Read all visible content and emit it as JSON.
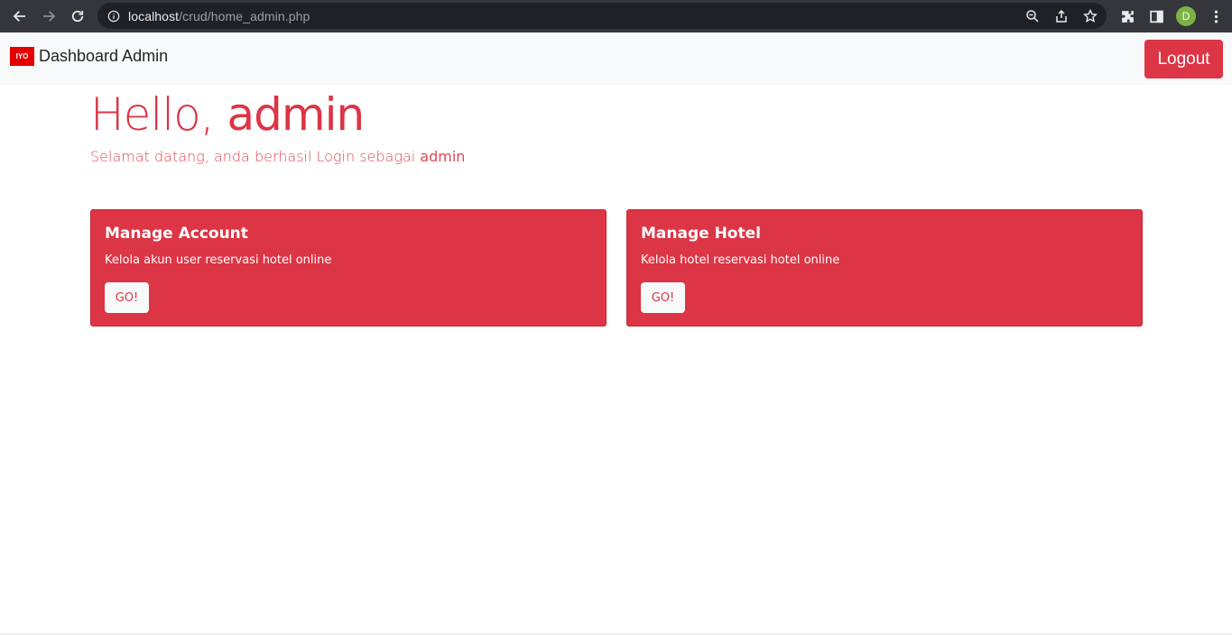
{
  "browser": {
    "url_host": "localhost",
    "url_path": "/crud/home_admin.php",
    "profile_initial": "D",
    "icons": [
      "back-icon",
      "forward-icon",
      "reload-icon",
      "info-icon",
      "zoom-icon",
      "share-icon",
      "star-icon",
      "extensions-icon",
      "side-panel-icon",
      "menu-icon"
    ]
  },
  "navbar": {
    "logo_text": "IYO",
    "brand": "Dashboard Admin",
    "logout_label": "Logout"
  },
  "main": {
    "greeting_prefix": "Hello, ",
    "greeting_user": "admin",
    "subtitle_prefix": "Selamat datang, anda berhasil Login sebagai ",
    "subtitle_user": "admin"
  },
  "cards": [
    {
      "title": "Manage Account",
      "text": "Kelola akun user reservasi hotel online",
      "button": "GO!"
    },
    {
      "title": "Manage Hotel",
      "text": "Kelola hotel reservasi hotel online",
      "button": "GO!"
    }
  ],
  "colors": {
    "accent": "#dc3545",
    "navbar_bg": "#f8f9fa",
    "logo_red": "#e30000"
  }
}
